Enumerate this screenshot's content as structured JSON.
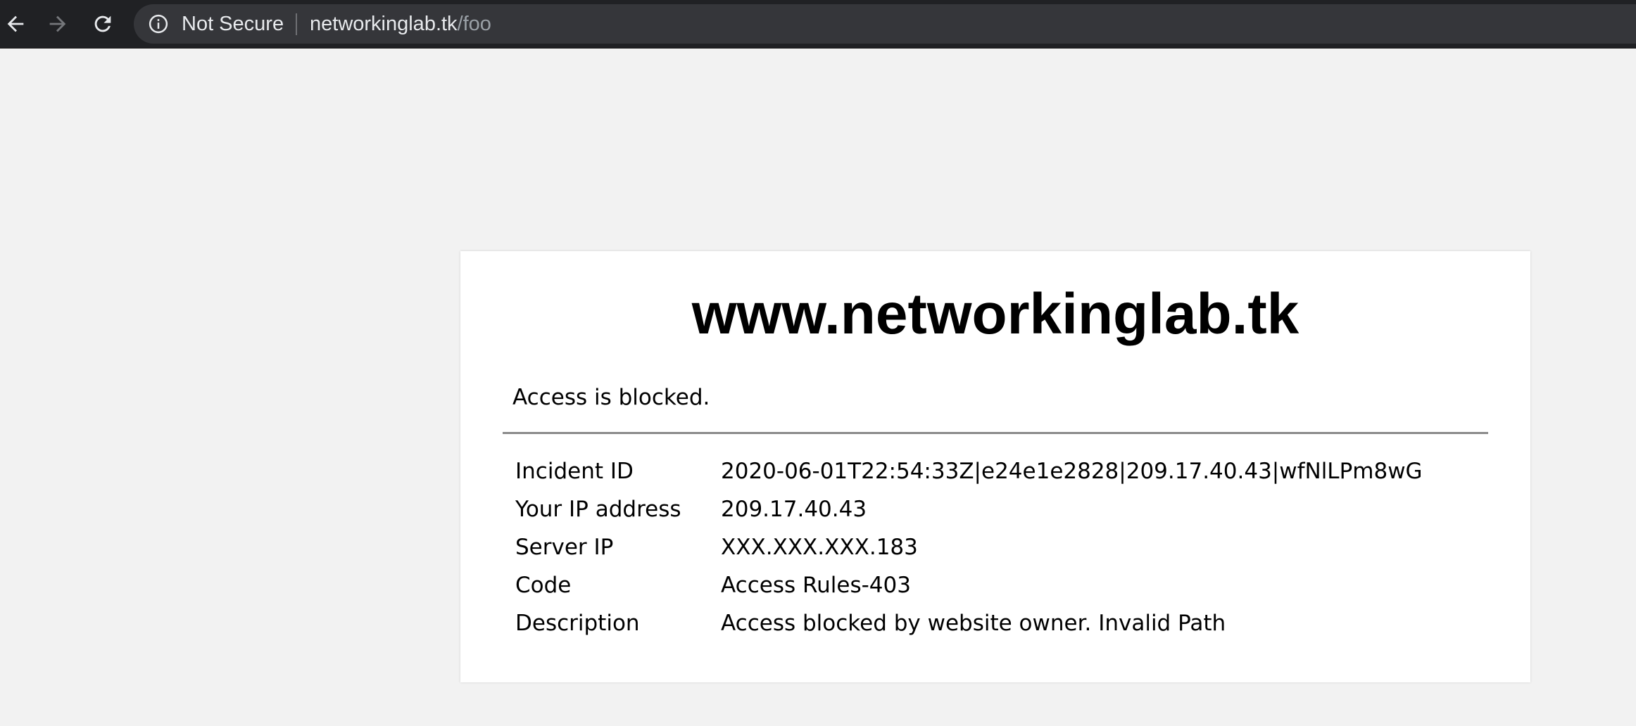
{
  "browser": {
    "security_label": "Not Secure",
    "url_host": "networkinglab.tk",
    "url_path": "/foo",
    "icons": {
      "back": "arrow-left-icon",
      "forward": "arrow-right-icon",
      "reload": "reload-icon",
      "info": "info-circle-icon"
    }
  },
  "page": {
    "heading": "www.networkinglab.tk",
    "message": "Access is blocked.",
    "details": [
      {
        "label": "Incident ID",
        "value": "2020-06-01T22:54:33Z|e24e1e2828|209.17.40.43|wfNlLPm8wG"
      },
      {
        "label": "Your IP address",
        "value": "209.17.40.43"
      },
      {
        "label": "Server IP",
        "value": "XXX.XXX.XXX.183"
      },
      {
        "label": "Code",
        "value": "Access Rules-403"
      },
      {
        "label": "Description",
        "value": "Access blocked by website owner. Invalid Path"
      }
    ]
  },
  "colors": {
    "toolbar": "#202124",
    "omnibox": "#35363a",
    "page_background": "#f2f2f2",
    "card": "#ffffff"
  }
}
